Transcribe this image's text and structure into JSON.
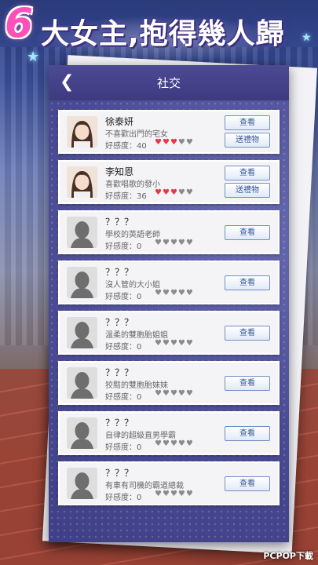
{
  "headline": {
    "number": "6",
    "text": "大女主,抱得幾人歸"
  },
  "screen": {
    "title": "社交"
  },
  "characters": [
    {
      "name": "徐泰妍",
      "desc": "不喜歡出門的宅女",
      "affinity_label": "好感度：40",
      "affinity_hearts_filled": 3,
      "affinity_hearts_total": 5,
      "view_label": "查看",
      "gift_label": "送禮物",
      "unlocked": true
    },
    {
      "name": "李知恩",
      "desc": "喜歡唱歌的發小",
      "affinity_label": "好感度：36",
      "affinity_hearts_filled": 3,
      "affinity_hearts_total": 5,
      "view_label": "查看",
      "gift_label": "送禮物",
      "unlocked": true
    },
    {
      "name": "？？？",
      "desc": "學校的英語老師",
      "affinity_label": "好感度：0",
      "affinity_hearts_filled": 0,
      "affinity_hearts_total": 5,
      "view_label": "查看",
      "unlocked": false
    },
    {
      "name": "？？？",
      "desc": "沒人管的大小姐",
      "affinity_label": "好感度：0",
      "affinity_hearts_filled": 0,
      "affinity_hearts_total": 5,
      "view_label": "查看",
      "unlocked": false
    },
    {
      "name": "？？？",
      "desc": "溫柔的雙胞胎姐姐",
      "affinity_label": "好感度：0",
      "affinity_hearts_filled": 0,
      "affinity_hearts_total": 5,
      "view_label": "查看",
      "unlocked": false
    },
    {
      "name": "？？？",
      "desc": "狡黠的雙胞胎妹妹",
      "affinity_label": "好感度：0",
      "affinity_hearts_filled": 0,
      "affinity_hearts_total": 5,
      "view_label": "查看",
      "unlocked": false
    },
    {
      "name": "？？？",
      "desc": "自律的超級直男學霸",
      "affinity_label": "好感度：0",
      "affinity_hearts_filled": 0,
      "affinity_hearts_total": 5,
      "view_label": "查看",
      "unlocked": false
    },
    {
      "name": "？？？",
      "desc": "有車有司機的霸道總裁",
      "affinity_label": "好感度：0",
      "affinity_hearts_filled": 0,
      "affinity_hearts_total": 5,
      "view_label": "查看",
      "unlocked": false
    }
  ],
  "watermark": "PCPOP下載",
  "colors": {
    "topbar": "#4c4a93",
    "heart_on": "#e03a48",
    "heart_off": "#8a8a8a",
    "headline_number": "#ff4fb8"
  },
  "icons": {
    "back": "back-arrow-icon",
    "heart": "heart-icon"
  }
}
